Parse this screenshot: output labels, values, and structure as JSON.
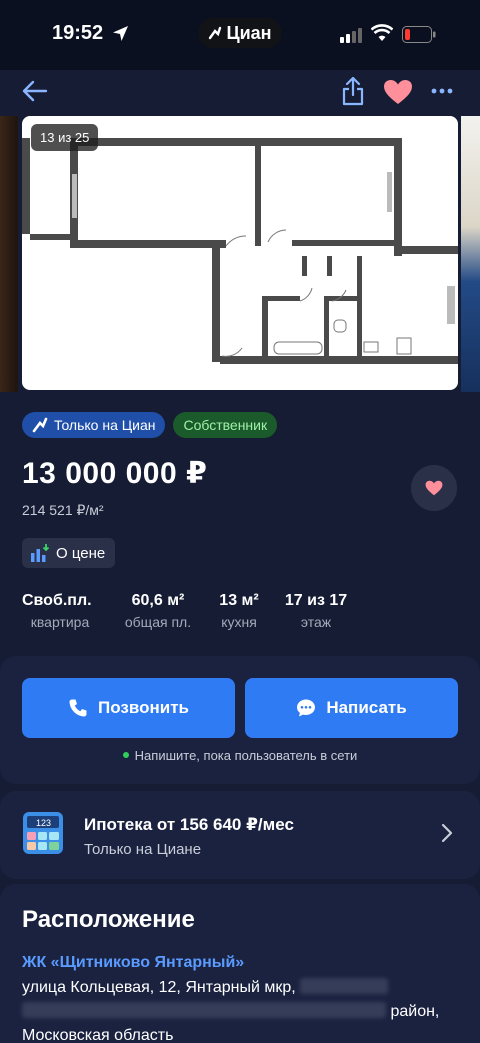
{
  "status_bar": {
    "time": "19:52",
    "brand": "Циан",
    "battery_color": "#ff3b30"
  },
  "toolbar": {
    "icons": [
      "back-arrow-icon",
      "share-icon",
      "heart-icon",
      "more-icon"
    ],
    "heart_color": "#ff8f9a"
  },
  "gallery": {
    "counter": "13 из 25"
  },
  "badges": {
    "cian_only": "Только на Циан",
    "owner": "Собственник"
  },
  "price": {
    "value": "13 000 000 ₽",
    "per_meter": "214 521 ₽/м²"
  },
  "price_info": {
    "label": "О цене"
  },
  "params": [
    {
      "value": "Своб.пл.",
      "label": "квартира"
    },
    {
      "value": "60,6 м²",
      "label": "общая пл."
    },
    {
      "value": "13 м²",
      "label": "кухня"
    },
    {
      "value": "17 из 17",
      "label": "этаж"
    }
  ],
  "actions": {
    "call_label": "Позвонить",
    "message_label": "Написать",
    "online_text": "Напишите, пока пользователь в сети",
    "accent": "#2f7bf4"
  },
  "mortgage": {
    "title": "Ипотека от 156 640 ₽/мес",
    "subtitle": "Только на Циане",
    "calc_display": "123"
  },
  "location": {
    "title": "Расположение",
    "complex_link": "ЖК «Щитниково Янтарный»",
    "street": "улица Кольцевая, 12, Янтарный мкр,",
    "district_suffix": "район,",
    "region": "Московская область",
    "link_color": "#5a9bff"
  }
}
